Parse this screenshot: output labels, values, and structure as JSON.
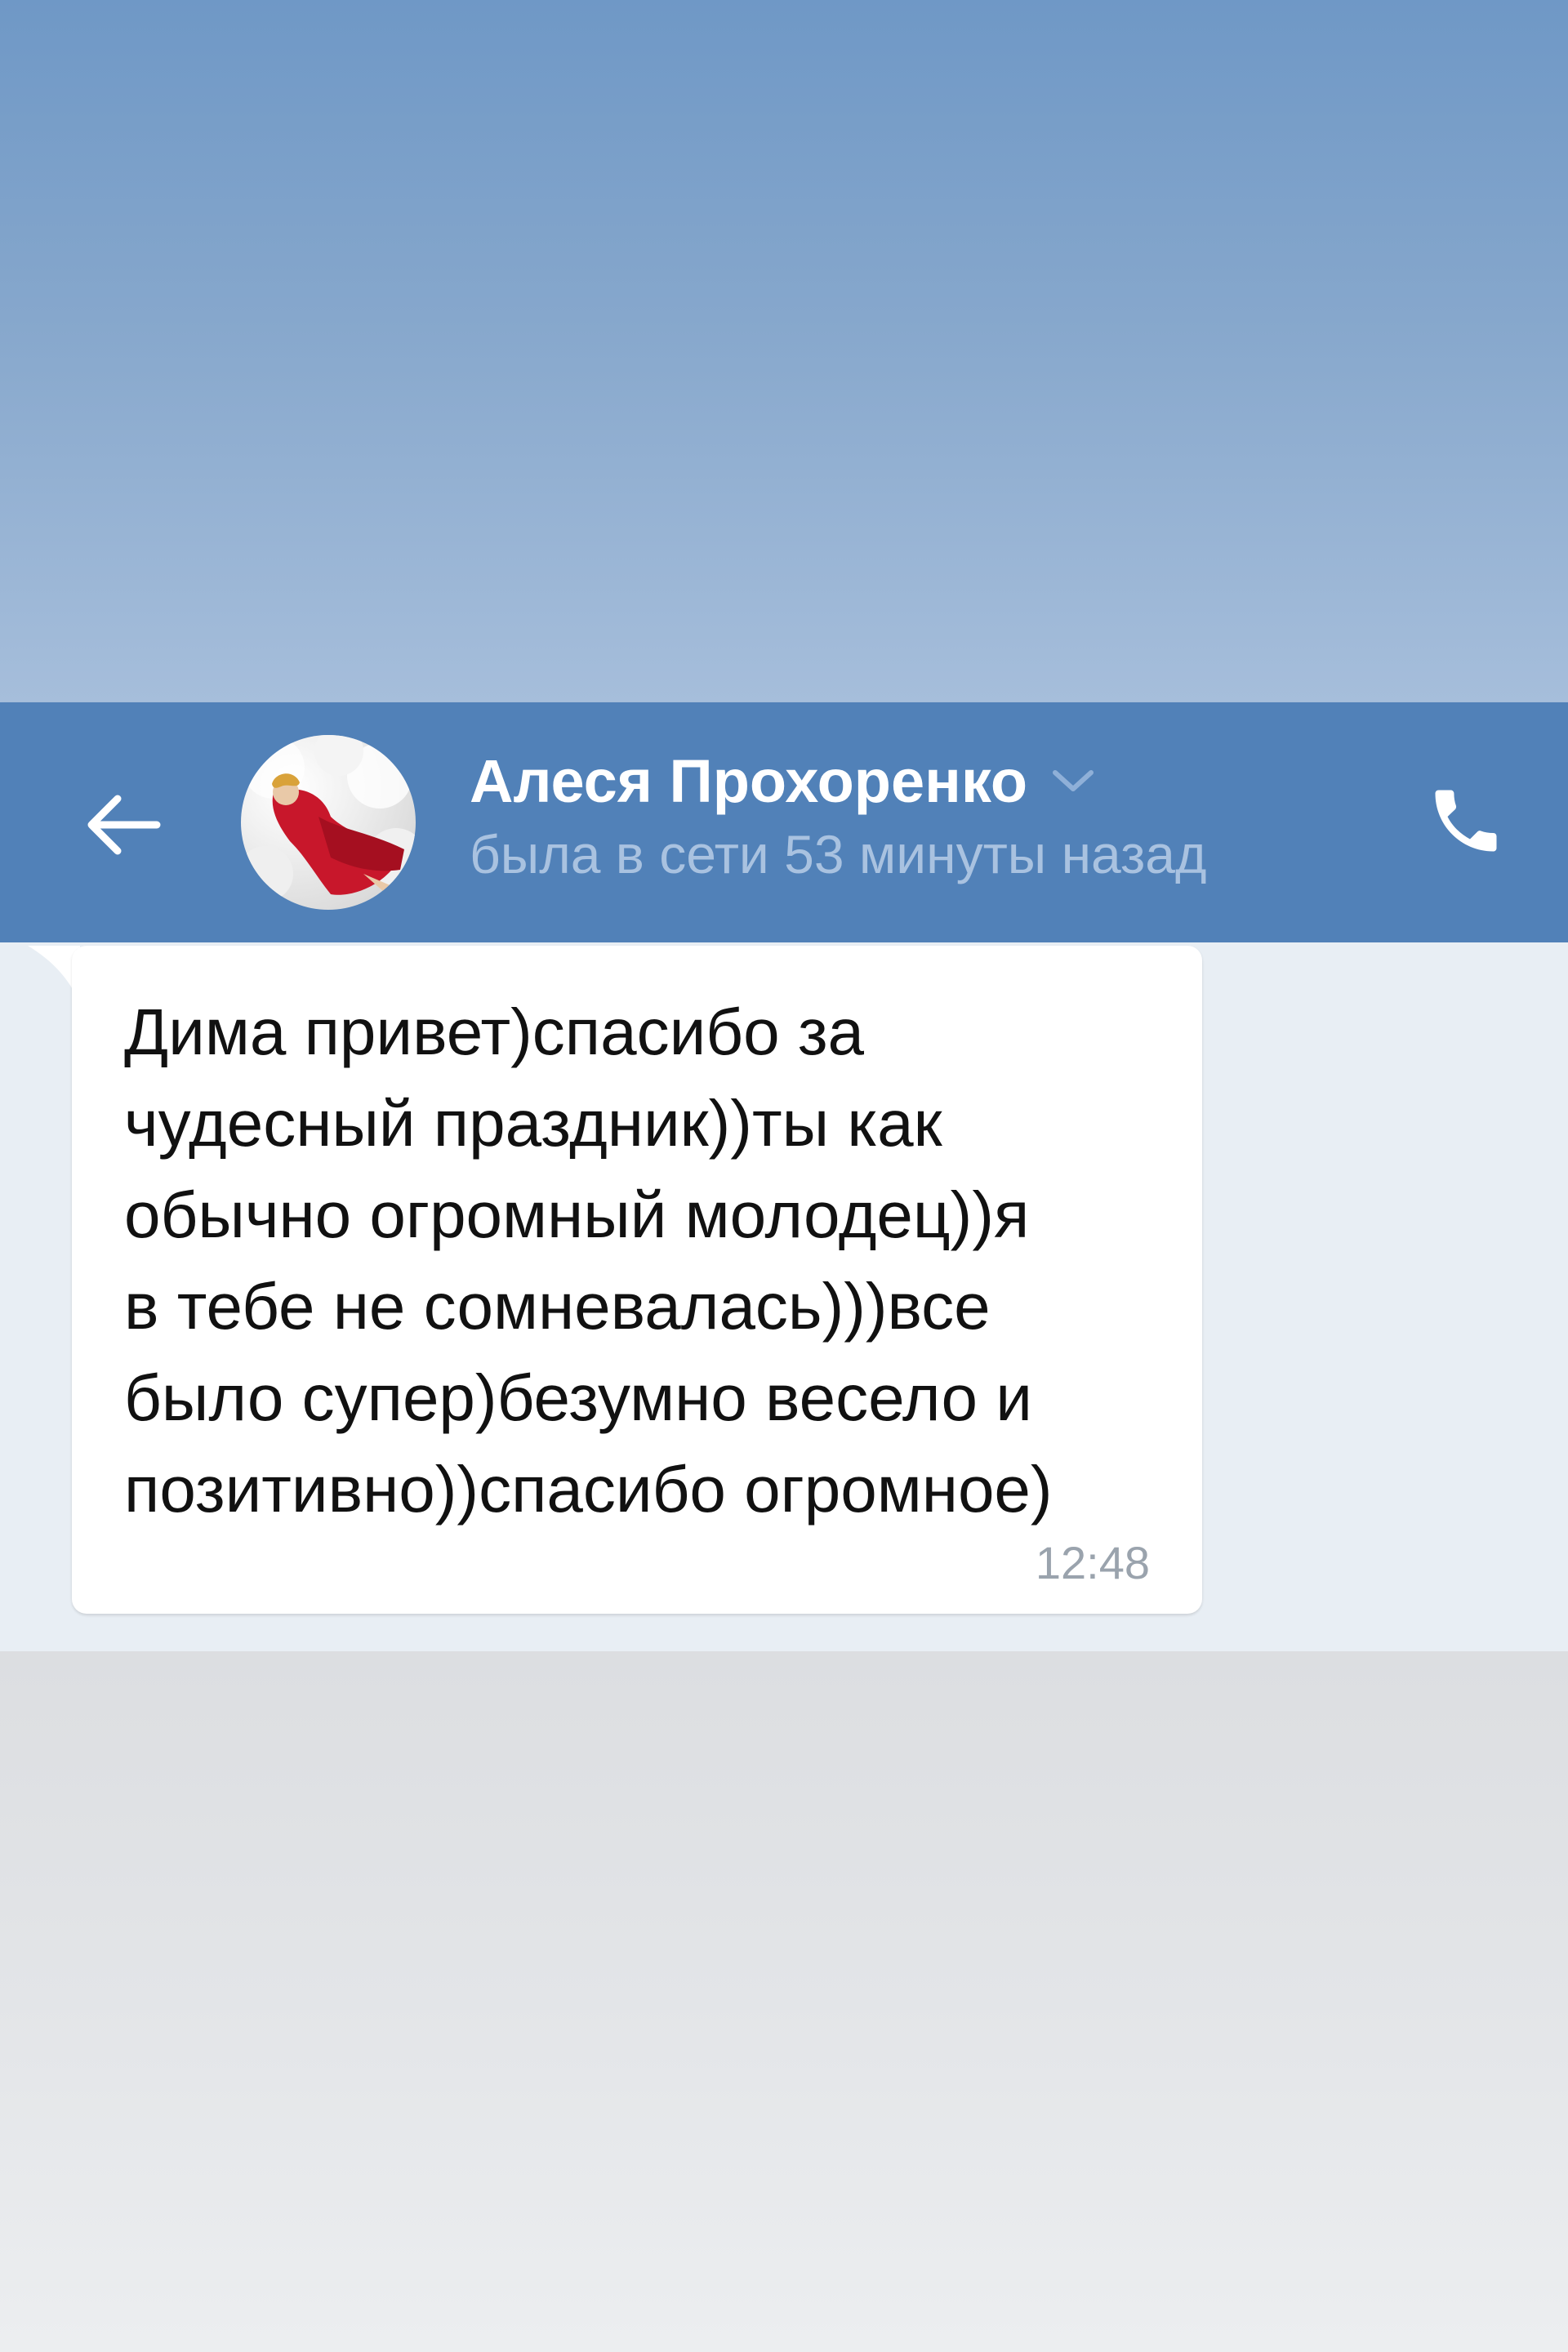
{
  "header": {
    "contact_name": "Алеся Прохоренко",
    "status": "была в сети 53 минуты назад",
    "accent_color": "#5181b8"
  },
  "icons": {
    "back": "arrow-left-icon",
    "chevron": "chevron-down-icon",
    "call": "phone-icon"
  },
  "messages": [
    {
      "text": "Дима привет)спасибо за\nчудесный праздник))ты как\nобычно огромный молодец))я\nв тебе не сомневалась)))все\nбыло супер)безумно весело и\nпозитивно))спасибо огромное)",
      "time": "12:48"
    }
  ]
}
